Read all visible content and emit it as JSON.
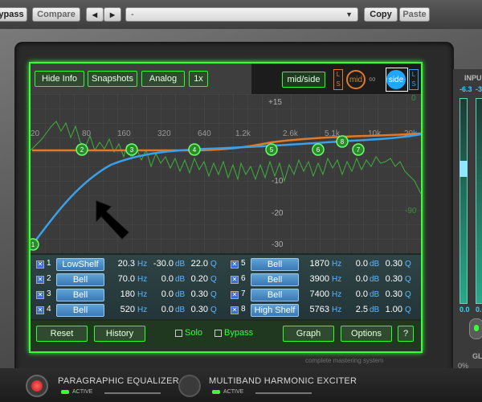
{
  "host": {
    "bypass_label": "ypass",
    "compare_label": "Compare",
    "prev_arrow": "◀",
    "next_arrow": "▶",
    "preset_value": "-",
    "copy_label": "Copy",
    "paste_label": "Paste"
  },
  "top_controls": {
    "hide_info": "Hide Info",
    "snapshots": "Snapshots",
    "analog": "Analog",
    "zoom": "1x",
    "mid_side": "mid/side",
    "mid": "mid",
    "side": "side",
    "link_box_left": "L S",
    "link_box_right": "L S"
  },
  "graph": {
    "db_labels": [
      "+15",
      "-10",
      "-20",
      "-30"
    ],
    "right_db_labels": [
      "0",
      "-90"
    ],
    "freq_labels": [
      "20",
      "80",
      "160",
      "320",
      "640",
      "1.2k",
      "2.6k",
      "5.1k",
      "10k",
      "20k"
    ],
    "node_labels": [
      "1",
      "2",
      "3",
      "4",
      "5",
      "6",
      "7",
      "8"
    ]
  },
  "bands": [
    {
      "num": "1",
      "type": "LowShelf",
      "freq": "20.3",
      "gain": "-30.0",
      "q": "22.0"
    },
    {
      "num": "2",
      "type": "Bell",
      "freq": "70.0",
      "gain": "0.0",
      "q": "0.20"
    },
    {
      "num": "3",
      "type": "Bell",
      "freq": "180",
      "gain": "0.0",
      "q": "0.30"
    },
    {
      "num": "4",
      "type": "Bell",
      "freq": "520",
      "gain": "0.0",
      "q": "0.30"
    },
    {
      "num": "5",
      "type": "Bell",
      "freq": "1870",
      "gain": "0.0",
      "q": "0.30"
    },
    {
      "num": "6",
      "type": "Bell",
      "freq": "3900",
      "gain": "0.0",
      "q": "0.30"
    },
    {
      "num": "7",
      "type": "Bell",
      "freq": "7400",
      "gain": "0.0",
      "q": "0.30"
    },
    {
      "num": "8",
      "type": "High Shelf",
      "freq": "5763",
      "gain": "2.5",
      "q": "1.00"
    }
  ],
  "units": {
    "hz": "Hz",
    "db": "dB",
    "q": "Q"
  },
  "actions": {
    "reset": "Reset",
    "history": "History",
    "solo": "Solo",
    "bypass": "Bypass",
    "graph": "Graph",
    "options": "Options",
    "help": "?"
  },
  "branding": {
    "footer": "complete mastering system"
  },
  "meters": {
    "input_label": "INPU",
    "left_peak": "-6.3",
    "right_peak": "-3",
    "left_bottom": "0.0",
    "right_bottom": "0.0",
    "gl_label": "GL",
    "pct_label": "0%"
  },
  "modules": [
    {
      "name": "PARAGRAPHIC EQUALIZER",
      "status": "ACTIVE"
    },
    {
      "name": "MULTIBAND HARMONIC EXCITER",
      "status": "ACTIVE"
    }
  ],
  "colors": {
    "accent_green": "#39ff39",
    "blue_curve": "#3aa0e8",
    "orange_curve": "#e07a2a",
    "blue_button": "#4a8ac4"
  }
}
